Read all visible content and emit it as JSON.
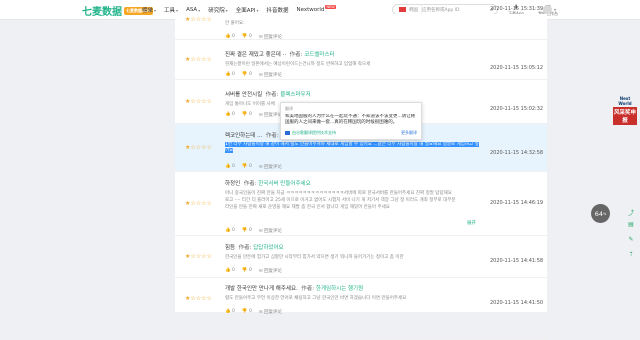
{
  "brand": {
    "name": "七麦数据",
    "badge": "七麦数据ASO"
  },
  "nav": [
    {
      "label": "榜单",
      "caret": true,
      "new": false
    },
    {
      "label": "工具",
      "caret": true,
      "new": false
    },
    {
      "label": "ASA",
      "caret": true,
      "new": false
    },
    {
      "label": "研究院",
      "caret": true,
      "new": false
    },
    {
      "label": "全面API",
      "caret": true,
      "new": false
    },
    {
      "label": "抖音数据",
      "caret": false,
      "new": false
    },
    {
      "label": "Nextworld",
      "caret": false,
      "new": true,
      "new_label": "NEW"
    }
  ],
  "search": {
    "store": "韩国",
    "placeholder": "应用名称或App ID"
  },
  "top_icons": [
    {
      "icon": "download-icon",
      "label": "下载App"
    },
    {
      "icon": "gift-icon",
      "label": "我的工作台"
    }
  ],
  "reviews": [
    {
      "stars": 1,
      "title": "",
      "author_label": "",
      "author": "",
      "body": "안 풀어요.",
      "likes": "0",
      "dislikes": "0",
      "reply": "回复评论",
      "date": "2020-11-15 15:31:39"
    },
    {
      "stars": 1,
      "title": "진짜 결은 재밌고 좋은데 ··",
      "author_label": "作者:",
      "author": "코드벨마스터",
      "body": "현재는잘이런 일본에서는 예상이런이드는건니까 정도 반복하고 입업해 락으세",
      "likes": "0",
      "dislikes": "0",
      "reply": "回复评论",
      "date": "2020-11-15 15:05:12"
    },
    {
      "stars": 1,
      "title": "서버를 안전시킬",
      "author_label": "作者:",
      "author": "블렉스마우저",
      "body": "게임 통아나도 어이를 사체",
      "likes": "0",
      "dislikes": "0",
      "reply": "回复评论",
      "date": "2020-11-15 15:02:32"
    },
    {
      "stars": 1,
      "title": "렉코인하는데 ...",
      "author_label": "作者:",
      "author": "",
      "body": "1번 너무 사람들이랑 해 같이 해서 렬도 만들어주셔야 제대로 게임할 수 있어요 ...같은 너무 사람들이랑 해 필요해요 정말로 게임하고 싶어요",
      "likes": "0",
      "dislikes": "0",
      "reply": "回复评论",
      "date": "2020-11-15 14:32:58"
    },
    {
      "stars": 1,
      "title": "하정인",
      "author_label": "作者:",
      "author": "한국서버 만들어주세요",
      "body": "아니 중국인들이 진짜 만들 지금 ㅋㅋㅋㅋㅋㅋㅋㅋㅋㅋㅋㅋㅋㅋ서버에 따로 한국서버를 만들어주세요 진짜 정말 답답해요",
      "body2": "로고 ···· 터간 더 플러어고 25세 이므로 이거고 없어도 시험지 서비 나기 게 저기서 객장 그냥 정 이러도 개최 정부로 대부분",
      "body3": "라인을 만들 진짜 새로 운영을 해요 제발 좀 한국 인서 합니다 게임 재밌어 만들어 주세요",
      "more": "展开",
      "likes": "0",
      "dislikes": "0",
      "reply": "回复评论",
      "date": "2020-11-15 14:46:19"
    },
    {
      "stars": 1,
      "title": "힘듬",
      "author_label": "作者:",
      "author": "답답하었어요",
      "body": "한국인을 만든에 힘가고 심할만 시작부터 힘가서 약으면 생기 뭐니까 들어가기는 정이고 좀 이한",
      "likes": "0",
      "dislikes": "0",
      "reply": "回复评论",
      "date": "2020-11-15 14:41:58"
    },
    {
      "stars": 1,
      "title": "개발 한국인만 만나게 해주세요.",
      "author_label": "作者:",
      "author": "한게임하시는 행기원",
      "body": "렬도 만들어주고 무언 이상한 언어로 채팅하고 그냥 한국인만 바면 하겠습니다 이면 만들어주세요",
      "likes": "0",
      "dislikes": "0",
      "reply": "回复评论",
      "date": "2020-11-15 14:41:50"
    },
    {
      "stars": 1,
      "title": "",
      "author_label": "",
      "author": "",
      "body": "",
      "likes": "",
      "dislikes": "",
      "reply": "",
      "date": ""
    }
  ],
  "popup": {
    "label": "翻译",
    "text": "和美地国服的人为什么在一起玩不通：不知道该不该变更...请让韩国服的人之间来做一套...真的在韩国玩的时候很困难的。",
    "source": "由谷歌翻译提供技术支持",
    "more": "更多翻译"
  },
  "side_ad": {
    "title": "Next World",
    "label": "风采奖申报"
  },
  "speed": {
    "value": "64",
    "unit": "%"
  },
  "side_icons": [
    "share-icon",
    "feedback-icon",
    "edit-icon",
    "top-icon"
  ]
}
